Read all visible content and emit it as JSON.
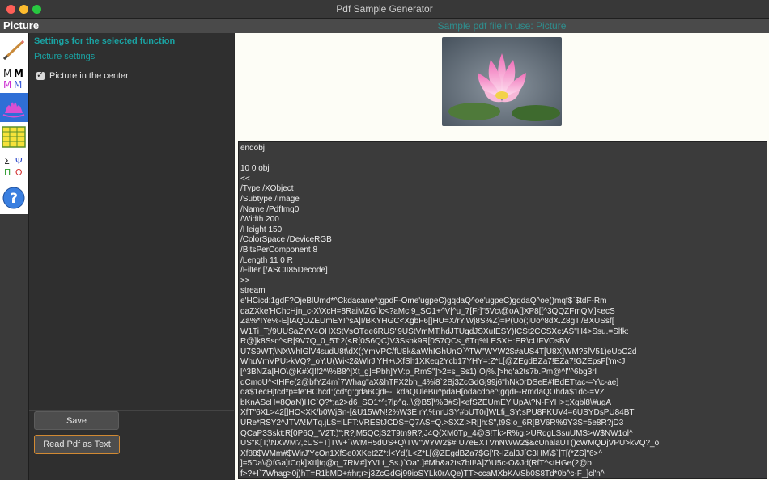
{
  "window": {
    "title": "Pdf Sample Generator"
  },
  "header": {
    "app_label": "Picture",
    "file_label": "Sample pdf file in use: Picture"
  },
  "toolbar": {
    "items": [
      {
        "name": "pencil-tool-icon",
        "glyph": ""
      },
      {
        "name": "text-tool-icon",
        "glyph": "MM\nMM"
      },
      {
        "name": "picture-tool-icon",
        "glyph": ""
      },
      {
        "name": "table-tool-icon",
        "glyph": ""
      },
      {
        "name": "symbols-tool-icon",
        "glyph": "Σ Ψ\nΠ Ω"
      },
      {
        "name": "help-tool-icon",
        "glyph": "?"
      }
    ]
  },
  "settings": {
    "heading": "Settings for the selected function",
    "subheading": "Picture settings",
    "checkbox_label": "Picture in the center",
    "checkbox_checked": true,
    "save_label": "Save",
    "read_label": "Read Pdf as Text"
  },
  "output": {
    "text": "endobj\n\n10 0 obj\n<<\n/Type /XObject\n/Subtype /Image\n/Name /PdfImg0\n/Width 200\n/Height 150\n/ColorSpace /DeviceRGB\n/BitsPerComponent 8\n/Length 11 0 R\n/Filter [/ASCII85Decode]\n>>\nstream\ne'HCicd:1gdF?OjeBlUmd*^Ckdacane^;gpdF-Ome'ugpeC)gqdaQ^oe'ugpeC)gqdaQ^oe()mqf$`$tdF-Rm\ndaZXke'HChcHjn_c-X\\XcH=8RaiMZG`lc<?aMc!9_SO1+^V[^u_7[Fr]\"5Vc\\@oA[]XP8[[^3QQZFmQM]<ecS\nZa%*!Ye%-E]!AQOZEUmEY!^sA]!/BKYHGC<XgbF6[]HU=X/rY,Wj8S%Z)=P(Uo(;iUo^8dX.Z8gT;/BXUSsf[\nW1Ti_T;/9UUSaZYV4OHXStVsOTqe6RUS\"9UStVmMT:hdJTUqdJSXuIESY)ICSt2CCSXc:AS\"H4>Ssu.=Slfk:\nR@]k8Ssc^<R[9V7Q_0_5T:2(<R[0S6QC)V3Ssbk9R[0S7QCs_6Tq%LESXH:ER\\cUFVOsBV\nU7S9WT;\\NXWhIGlV4sudU8t\\dX(;YmVPC/fU8k&aWhIGhUnO`^TW\"WYW2$#aUS4T[U8X]WM?5fV51)eUoC2d\nWhuVmVPU>kVQ?_oY,U(Wi<2&WlrJ'YH+\\.XfSh1XKeq2Ycb17YHY=:Z*L[@ZEgdBZa7!EZa7!GZEpsF['m<J\n[^3BNZa[HO\\@K#X]!f2^\\%B8^]Xt_g]=Pbh]YV:p_RmS\"]>2=s_Ss1)`Oj%.]>hq'a2ts7b.Pm@^!\"^6bg3rl\ndCmoU^<tHFe(2@bfYZ4m`7Whag\"aX&hTFX2bh_4%i8`2Bj3ZcGdGj99j6\"hNk0rDSeE#fBdETtac-=Y\\c-ae]\nda$1ecHjtcd*p=fe'HChcd:(cd*g:gda6CjdF-LkdaQUleBu^pdaH[odacdoe^;gqdF-RmdaQOhda$1dc-=VZ\nbKnAScH=8QaN)HC`Q?*;a2>d6_SO1*^;7lp^q..\\@B5]\\%B#S]<efSZEUmEYlUpA\\?N-FYH>:;Xgbl8\\#ugA\nXfT\"6XL>42[]HO<XK/b0WjSn-[&U15WN!2%W3E.rY,%nrUSY#bUT0r]WLfi_SY;sPU8FKUV4=6USYDsPU84BT\nURe*RSY2^JTVA!MTq.jLS=lLFT:VREStJCDS=Q7AS=Q.>SXZ.>R[]h:S\",t9S!o_6R[BV6R%9Y3S=5e8R?jD3\nQCaP3Sskt:R[0P6Q_'V2T:)\";R?jM5QCjS2T9tn9R?jJ4Q(XM0Tp_4@S!Tk>R%g.>URdgLSsuUMS>W$NW1ol^\nUS\"K[T;\\NXWM?,cUS+T]TW+`\\WMH5dUS+Q\\TW\"WYW2$#`U7eEXTVnNWW2$&cUnalaUT()cWMQDjVPU>kVQ?_o\nXf88$WMm#$WirJ'YcOn1XfSe0XKet2Z*:l<Yd(L<Z*L[@ZEgdBZa7$G['R-IZal3J[C3HM\\$`]T[(*ZS]\"6>^\n]=5Da\\@fGa]tCqk]XtI]tq@q_7RM#]YVLt_Ss.)`Oa\".]#Mh&a2ts7bII!A]Z\\U5c-O&Jd(RfT^<tHGe(2@b\nf>?+I`7Whag>0j)hT=R1bMD+#hr;r>j3ZcGdGj99ioSYLk0rAQe)TT>ccaMXbKA/Sb0S8Td*0b^c-F_]cl'n^"
  }
}
